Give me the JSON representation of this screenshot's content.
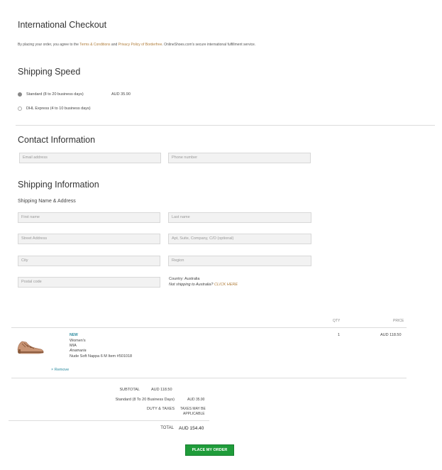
{
  "header": {
    "title": "International Checkout",
    "notice_prefix": "By placing your order, you agree to the ",
    "terms_link": "Terms & Conditions",
    "notice_and": " and ",
    "privacy_link": "Privacy Policy of Borderfree",
    "notice_suffix": ". OnlineShoes.com's secure international fulfillment service."
  },
  "shipping_speed": {
    "title": "Shipping Speed",
    "options": [
      {
        "label": "Standard (8 to 20 business days)",
        "price": "AUD 35.90",
        "selected": true
      },
      {
        "label": "DHL Express (4 to 10 business days)",
        "price": "",
        "selected": false
      }
    ]
  },
  "contact": {
    "title": "Contact Information",
    "email_placeholder": "Email address",
    "phone_placeholder": "Phone number"
  },
  "shipping_info": {
    "title": "Shipping Information",
    "subtitle": "Shipping Name & Address",
    "first_name_placeholder": "First name",
    "last_name_placeholder": "Last name",
    "street_placeholder": "Street Address",
    "apt_placeholder": "Apt, Suite, Company, C/O (optional)",
    "city_placeholder": "City",
    "region_placeholder": "Region",
    "postal_placeholder": "Postal code",
    "country_text": "Country: Australia",
    "not_shipping_text": "Not shipping to Australia?",
    "click_here": "CLICK HERE"
  },
  "cart": {
    "col_qty": "QTY",
    "col_price": "PRICE",
    "item": {
      "badge": "NEW",
      "line1": "Women's",
      "line2": "MIA",
      "line3": "Anamaria",
      "line4": "Nude Soft Nappa 6 M Item #501018",
      "qty": "1",
      "price": "AUD 118.50",
      "remove": "Remove"
    }
  },
  "summary": {
    "subtotal_label": "SUBTOTAL",
    "subtotal_value": "AUD 118.50",
    "shipping_label": "Standard (8 To 20 Business Days)",
    "shipping_value": "AUD 35.90",
    "duty_label": "DUTY & TAXES",
    "duty_value_1": "TAXES MAY BE",
    "duty_value_2": "APPLICABLE",
    "total_label": "TOTAL",
    "total_value": "AUD 154.40"
  },
  "place_order_label": "PLACE MY ORDER",
  "colors": {
    "accent_link": "#b07d3a",
    "button_green": "#1f9c3a",
    "badge_teal": "#2a8a9e"
  }
}
